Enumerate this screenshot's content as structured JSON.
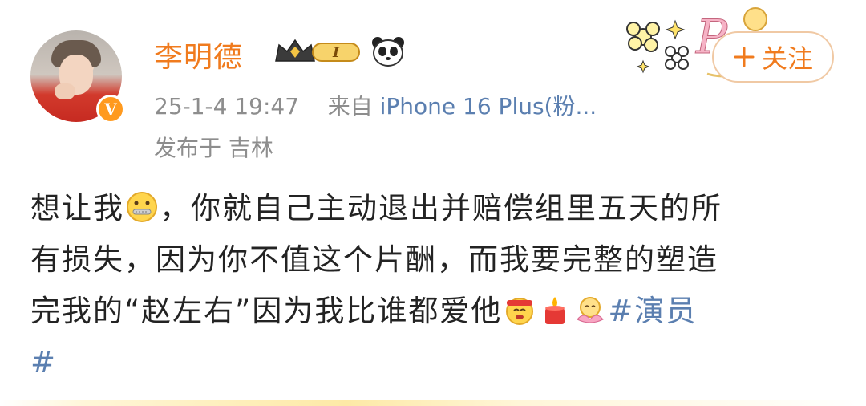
{
  "post": {
    "user": {
      "name": "李明德",
      "verified_badge": "V"
    },
    "member_badge": {
      "text": "I"
    },
    "meta": {
      "date": "25-1-4 19:47",
      "from_label": "来自",
      "source": "iPhone 16 Plus(粉..."
    },
    "location": "发布于 吉林",
    "follow_button": {
      "label": "关注",
      "icon": "plus-icon"
    },
    "body": {
      "line1_a": "想让我",
      "line1_b": "，你就自己主动退出并赔偿组里五天的所",
      "line2": "有损失，因为你不值这个片酬，而我要完整的塑造",
      "line3": "完我的“赵左右”因为我比谁都爱他",
      "hashtag_part1": "#演员",
      "hashtag_part2": "#"
    },
    "emojis": [
      "zipper-mouth-emoji",
      "cheer-emoji",
      "candle-emoji",
      "lotus-emoji"
    ]
  },
  "colors": {
    "username": "#f07b1e",
    "meta": "#8d8d8d",
    "source": "#5b7fb0",
    "hashtag": "#5b7fb0",
    "verified": "#ff9a1f",
    "follow_border": "#f0c9a4"
  }
}
